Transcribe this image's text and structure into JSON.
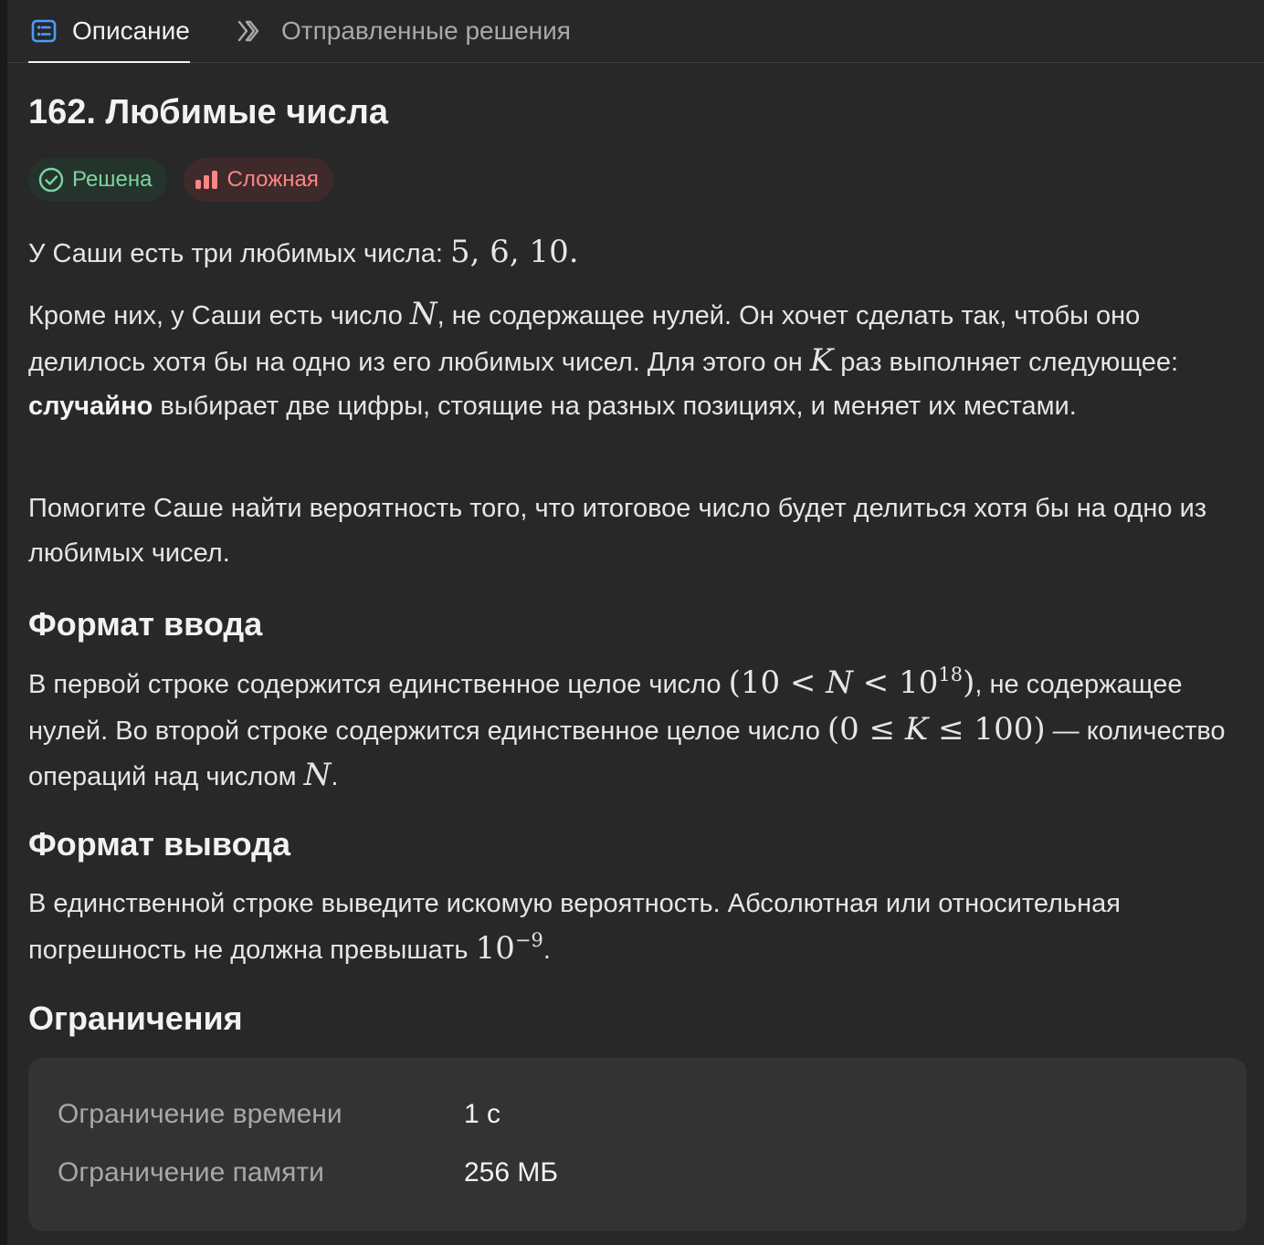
{
  "tabs": {
    "description_label": "Описание",
    "submissions_label": "Отправленные решения",
    "description_icon": "document-list-icon",
    "submissions_icon": "double-chevron-right-icon"
  },
  "problem": {
    "title": "162. Любимые числа",
    "status_badge": "Решена",
    "difficulty_badge": "Сложная",
    "statement": {
      "p1_prefix": "У Саши есть три любимых числа: ",
      "p1_math": "5, 6, 10.",
      "p2_a": "Кроме них, у Саши есть число ",
      "p2_N": "N",
      "p2_b": ", не содержащее нулей. Он хочет сделать так, чтобы оно делилось хотя бы на одно из его любимых чисел. Для этого он ",
      "p2_K": "K",
      "p2_c": " раз выполняет следующее: ",
      "p2_bold": "случайно",
      "p2_d": " выбирает две цифры, стоящие на разных позициях, и меняет их местами.",
      "p3": "Помогите Саше найти вероятность того, что итоговое число будет делиться хотя бы на одно из любимых чисел."
    },
    "input_format": {
      "heading": "Формат ввода",
      "a": "В первой строке содержится единственное целое число ",
      "math1_pre": "(10 < ",
      "math1_N": "N",
      "math1_mid": " < 10",
      "math1_exp": "18",
      "math1_post": ")",
      "b": ", не содержащее нулей. Во второй строке содержится единственное целое число ",
      "math2_pre": "(0 ≤",
      "math2_K": "K",
      "math2_post": " ≤ 100)",
      "c": " — количество операций над числом ",
      "math3_N": "N",
      "d": "."
    },
    "output_format": {
      "heading": "Формат вывода",
      "a": "В единственной строке выведите искомую вероятность. Абсолютная или относительная погрешность не должна превышать ",
      "math_base": "10",
      "math_exp": "−9",
      "b": "."
    },
    "limits": {
      "heading": "Ограничения",
      "rows": [
        {
          "label": "Ограничение времени",
          "value": "1 с"
        },
        {
          "label": "Ограничение памяти",
          "value": "256 МБ"
        }
      ]
    }
  },
  "colors": {
    "panel_bg": "#282828",
    "solved_text": "#7fd2a0",
    "hard_text": "#ff8585",
    "tab_icon_blue": "#4a9cff"
  }
}
